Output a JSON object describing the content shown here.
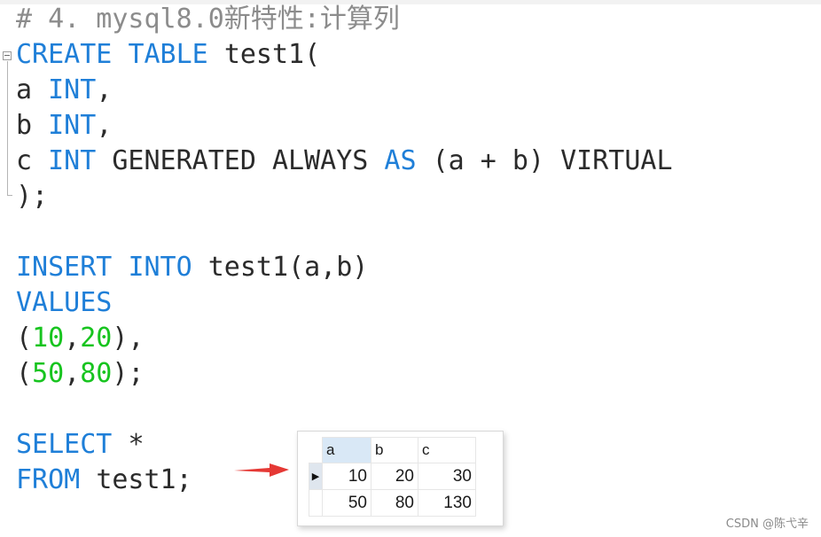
{
  "editor": {
    "comment": "# 4. mysql8.0新特性:计算列",
    "create": {
      "kw_create": "CREATE",
      "kw_table": "TABLE",
      "table_open": "test1("
    },
    "col_a": {
      "name": "a",
      "type": "INT",
      "end": ","
    },
    "col_b": {
      "name": "b",
      "type": "INT",
      "end": ","
    },
    "col_c": {
      "name": "c",
      "type": "INT",
      "generated": "GENERATED ALWAYS",
      "kw_as": "AS",
      "expr": "(a + b) VIRTUAL"
    },
    "close": ");",
    "insert": {
      "kw_insert": "INSERT",
      "kw_into": "INTO",
      "target": "test1(a,b)",
      "kw_values": "VALUES",
      "row1": {
        "open": "(",
        "v1": "10",
        "sep": ",",
        "v2": "20",
        "close": "),"
      },
      "row2": {
        "open": "(",
        "v1": "50",
        "sep": ",",
        "v2": "80",
        "close": ");"
      }
    },
    "select": {
      "kw_select": "SELECT",
      "star": "*",
      "kw_from": "FROM",
      "target": "test1;"
    }
  },
  "result_grid": {
    "columns": [
      "a",
      "b",
      "c"
    ],
    "rows": [
      [
        "10",
        "20",
        "30"
      ],
      [
        "50",
        "80",
        "130"
      ]
    ],
    "current_row_marker": "▶"
  },
  "watermark": "CSDN @陈弋辛",
  "colors": {
    "keyword": "#1f7fd8",
    "number": "#17c41f",
    "comment": "#8c8c8c",
    "arrow": "#e53935",
    "selected_header": "#d9e8f6"
  }
}
